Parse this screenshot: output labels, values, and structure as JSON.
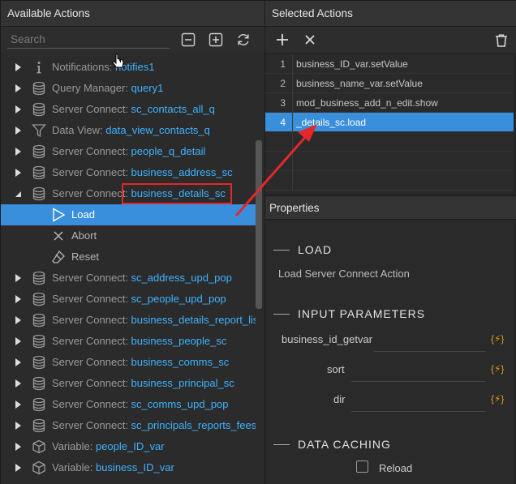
{
  "left_panel": {
    "title": "Available Actions",
    "search_placeholder": "Search"
  },
  "tree": [
    {
      "kind": "Notifications: ",
      "name": "notifies1",
      "icon": "info-icon",
      "expanded": false
    },
    {
      "kind": "Query Manager: ",
      "name": "query1",
      "icon": "database-icon",
      "expanded": false
    },
    {
      "kind": "Server Connect: ",
      "name": "sc_contacts_all_q",
      "icon": "database-icon",
      "expanded": false
    },
    {
      "kind": "Data View: ",
      "name": "data_view_contacts_q",
      "icon": "filter-icon",
      "expanded": false
    },
    {
      "kind": "Server Connect: ",
      "name": "people_q_detail",
      "icon": "database-icon",
      "expanded": false
    },
    {
      "kind": "Server Connect: ",
      "name": "business_address_sc",
      "icon": "database-icon",
      "expanded": false
    },
    {
      "kind": "Server Connect: ",
      "name": "business_details_sc",
      "icon": "database-icon",
      "expanded": true
    },
    {
      "child": "Load",
      "icon": "play-icon",
      "selected": true
    },
    {
      "child": "Abort",
      "icon": "x-icon"
    },
    {
      "child": "Reset",
      "icon": "eraser-icon"
    },
    {
      "kind": "Server Connect: ",
      "name": "sc_address_upd_pop",
      "icon": "database-icon",
      "expanded": false
    },
    {
      "kind": "Server Connect: ",
      "name": "sc_people_upd_pop",
      "icon": "database-icon",
      "expanded": false
    },
    {
      "kind": "Server Connect: ",
      "name": "business_details_report_list",
      "icon": "database-icon",
      "expanded": false
    },
    {
      "kind": "Server Connect: ",
      "name": "business_people_sc",
      "icon": "database-icon",
      "expanded": false
    },
    {
      "kind": "Server Connect: ",
      "name": "business_comms_sc",
      "icon": "database-icon",
      "expanded": false
    },
    {
      "kind": "Server Connect: ",
      "name": "business_principal_sc",
      "icon": "database-icon",
      "expanded": false
    },
    {
      "kind": "Server Connect: ",
      "name": "sc_comms_upd_pop",
      "icon": "database-icon",
      "expanded": false
    },
    {
      "kind": "Server Connect: ",
      "name": "sc_principals_reports_fees",
      "icon": "database-icon",
      "expanded": false
    },
    {
      "kind": "Variable: ",
      "name": "people_ID_var",
      "icon": "cube-icon",
      "expanded": false
    },
    {
      "kind": "Variable: ",
      "name": "business_ID_var",
      "icon": "cube-icon",
      "expanded": false
    }
  ],
  "right_panel": {
    "title": "Selected Actions",
    "selected_actions": [
      {
        "num": "1",
        "text": "business_ID_var.setValue"
      },
      {
        "num": "2",
        "text": "business_name_var.setValue"
      },
      {
        "num": "3",
        "text": "mod_business_add_n_edit.show"
      },
      {
        "num": "4",
        "text": "_details_sc.load",
        "selected": true
      }
    ]
  },
  "properties": {
    "title": "Properties",
    "load_heading": "LOAD",
    "description": "Load Server Connect Action",
    "input_heading": "INPUT PARAMETERS",
    "params": [
      "business_id_getvar",
      "sort",
      "dir"
    ],
    "caching_heading": "DATA CACHING",
    "reload_label": "Reload"
  },
  "colors": {
    "accent": "#3a8fdc",
    "name_text": "#3fb3ff",
    "bolt": "#e89a1c",
    "callout": "#e2282b"
  }
}
